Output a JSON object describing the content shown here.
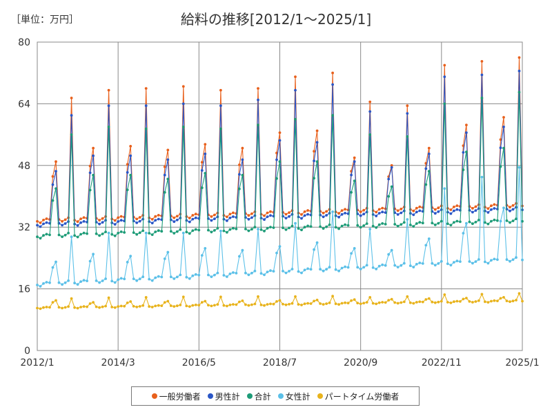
{
  "unit_label": "［単位：万円］",
  "chart_data": {
    "type": "line",
    "title": "給料の推移[2012/1～2025/1]",
    "xlabel": "",
    "ylabel": "",
    "ylim": [
      0,
      80
    ],
    "y_ticks": [
      "0",
      "16",
      "32",
      "48",
      "64",
      "80"
    ],
    "x_range": [
      "2012-01",
      "2025-01"
    ],
    "x_ticks": [
      {
        "date": "2012-01",
        "label": "2012/1"
      },
      {
        "date": "2014-03",
        "label": "2014/3"
      },
      {
        "date": "2016-05",
        "label": "2016/5"
      },
      {
        "date": "2018-07",
        "label": "2018/7"
      },
      {
        "date": "2020-09",
        "label": "2020/9"
      },
      {
        "date": "2022-11",
        "label": "2022/11"
      },
      {
        "date": "2025-01",
        "label": "2025/1"
      }
    ],
    "grid": true,
    "legend_position": "bottom",
    "annual_pattern": "monthly values with peaks in June-July (summer bonus) and December (winter bonus)",
    "series": [
      {
        "name": "一般労働者",
        "color": "#e8601c",
        "base_start": 33.5,
        "base_end": 37.5,
        "summer_peaks": [
          49,
          52.5,
          53,
          52,
          53.5,
          52.5,
          56.5,
          57,
          50,
          48,
          52.5,
          58.5,
          60.5,
          61
        ],
        "winter_peaks": [
          65.5,
          67.5,
          68,
          68.5,
          67.5,
          68,
          71,
          72,
          64.5,
          63.5,
          74,
          75,
          76
        ]
      },
      {
        "name": "男性計",
        "color": "#2a56c6",
        "base_start": 32.5,
        "base_end": 36.5,
        "summer_peaks": [
          46.5,
          50.5,
          50.5,
          49.5,
          51,
          49.5,
          54.5,
          54,
          49,
          47.5,
          51,
          56.5,
          58,
          57.5
        ],
        "winter_peaks": [
          61,
          63.5,
          63.5,
          64,
          63.5,
          65,
          67.5,
          69,
          62,
          61.5,
          71,
          71.5,
          72.5
        ]
      },
      {
        "name": "合計",
        "color": "#1e9c78",
        "base_start": 29.5,
        "base_end": 33.5,
        "summer_peaks": [
          42,
          45.5,
          45.5,
          44.5,
          46,
          45.5,
          49,
          49,
          44,
          42.5,
          46.5,
          51.5,
          52.5,
          52.5
        ],
        "winter_peaks": [
          56,
          58,
          57.5,
          58,
          57.5,
          58.5,
          60,
          61,
          56,
          55.5,
          64,
          65.5,
          67
        ]
      },
      {
        "name": "女性計",
        "color": "#5bc0e8",
        "base_start": 17,
        "base_end": 23.5,
        "summer_peaks": [
          23,
          25,
          24.5,
          25.5,
          26.5,
          26,
          27,
          28,
          26.5,
          26,
          29,
          33,
          37,
          39.5
        ],
        "winter_peaks": [
          29.5,
          30.5,
          30.5,
          30.5,
          31,
          31.5,
          33,
          36,
          31.5,
          34,
          42,
          45,
          47.5
        ]
      },
      {
        "name": "パートタイム労働者",
        "color": "#e8b31c",
        "base_start": 11,
        "base_end": 12.8,
        "summer_peaks": [
          13,
          12.5,
          12.7,
          12.8,
          12.8,
          12.9,
          13,
          13.1,
          13.2,
          13.3,
          13.5,
          13.6,
          13.8,
          14
        ],
        "winter_peaks": [
          13.5,
          13.7,
          13.8,
          13.9,
          13.9,
          14,
          14,
          14.1,
          13.8,
          14,
          14.5,
          14.6,
          14.8
        ]
      }
    ]
  }
}
